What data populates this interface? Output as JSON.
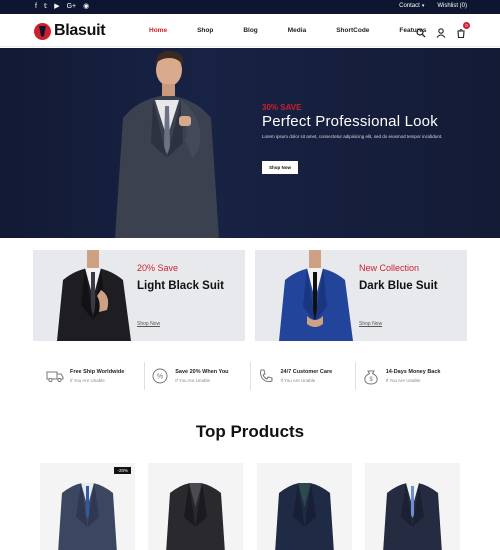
{
  "topbar": {
    "social_icons": [
      "facebook-icon",
      "twitter-icon",
      "youtube-icon",
      "google-plus-icon",
      "instagram-icon"
    ],
    "contact_label": "Contact",
    "wishlist_label": "Wishlist (0)"
  },
  "brand": {
    "name": "Blasuit",
    "accent": "#d01f2c",
    "navy": "#0d1530"
  },
  "nav": {
    "items": [
      {
        "label": "Home",
        "active": true
      },
      {
        "label": "Shop",
        "active": false
      },
      {
        "label": "Blog",
        "active": false
      },
      {
        "label": "Media",
        "active": false
      },
      {
        "label": "ShortCode",
        "active": false
      },
      {
        "label": "Features",
        "active": false
      }
    ],
    "cart_count": "0"
  },
  "hero": {
    "subtitle": "30% SAVE",
    "title": "Perfect Professional Look",
    "description": "Lorem ipsum dolor sit amet, consectetur adipisicing elit, sed do eiusmod tempor incididunt.",
    "button": "Shop Now"
  },
  "banners": [
    {
      "subtitle": "20% Save",
      "title": "Light Black Suit",
      "link": "Shop Now"
    },
    {
      "subtitle": "New Collection",
      "title": "Dark Blue Suit",
      "link": "Shop Now"
    }
  ],
  "features": [
    {
      "icon": "truck-icon",
      "title": "Free Ship Worldwide",
      "text": "If You Are Unable"
    },
    {
      "icon": "discount-icon",
      "title": "Save 20% When You",
      "text": "If You Are Unable"
    },
    {
      "icon": "phone-icon",
      "title": "24/7 Customer Care",
      "text": "If You Are Unable"
    },
    {
      "icon": "money-bag-icon",
      "title": "14-Days Money Back",
      "text": "If You Are Unable"
    }
  ],
  "products_section": {
    "title": "Top Products",
    "products": [
      {
        "badge": "-20%"
      },
      {
        "badge": ""
      },
      {
        "badge": ""
      },
      {
        "badge": ""
      }
    ]
  }
}
